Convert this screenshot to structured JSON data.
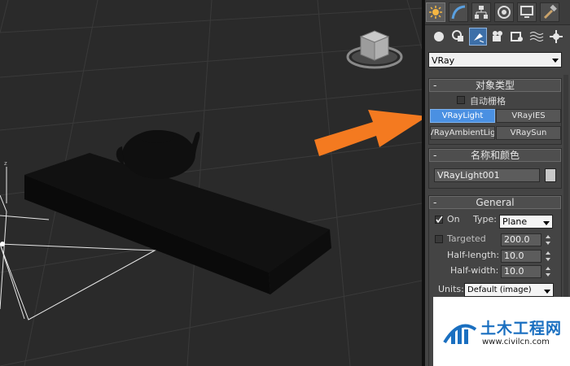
{
  "command_panel": {
    "tabs": [
      {
        "icon": "create-icon",
        "active": true
      },
      {
        "icon": "modify-icon"
      },
      {
        "icon": "hierarchy-icon"
      },
      {
        "icon": "motion-icon"
      },
      {
        "icon": "display-icon"
      },
      {
        "icon": "utilities-icon"
      }
    ],
    "categories": [
      {
        "icon": "geometry-icon"
      },
      {
        "icon": "shapes-icon"
      },
      {
        "icon": "lights-icon",
        "active": true
      },
      {
        "icon": "cameras-icon"
      },
      {
        "icon": "helpers-icon"
      },
      {
        "icon": "space-warps-icon"
      },
      {
        "icon": "systems-icon"
      }
    ],
    "renderer_dropdown": "VRay",
    "object_type": {
      "title": "对象类型",
      "collapse": "-",
      "autogrid_label": "自动栅格",
      "buttons": [
        "VRayLight",
        "VRayIES",
        "VRayAmbientLight",
        "VRaySun"
      ],
      "selected": "VRayLight"
    },
    "name_color": {
      "title": "名称和颜色",
      "collapse": "-",
      "name_value": "VRayLight001",
      "color": "#c8c8c8"
    },
    "general": {
      "title": "General",
      "collapse": "-",
      "on_label": "On",
      "on_checked": true,
      "type_label": "Type:",
      "type_value": "Plane",
      "targeted_label": "Targeted",
      "targeted_value": "200.0",
      "half_length_label": "Half-length:",
      "half_length_value": "10.0",
      "half_width_label": "Half-width:",
      "half_width_value": "10.0",
      "units_label": "Units:",
      "units_value": "Default (image)"
    }
  },
  "viewport": {
    "background": "#2a2a2a",
    "annotation_arrow_color": "#f47a20"
  },
  "watermark": {
    "title": "土木工程网",
    "url": "www.civilcn.com",
    "color": "#1a6fc0"
  }
}
